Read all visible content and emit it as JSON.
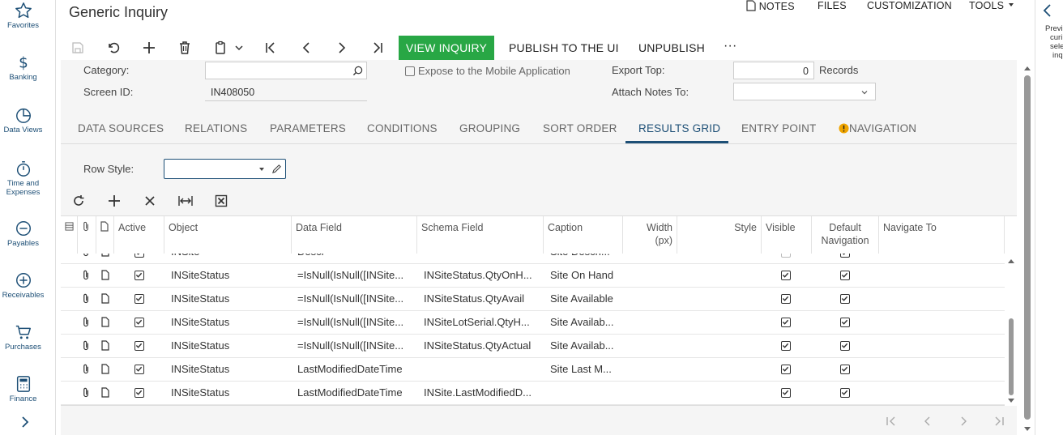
{
  "nav": {
    "items": [
      {
        "label": "Favorites"
      },
      {
        "label": "Banking"
      },
      {
        "label": "Data Views"
      },
      {
        "label": "Time and Expenses",
        "line1": "Time and",
        "line2": "Expenses"
      },
      {
        "label": "Payables"
      },
      {
        "label": "Receivables"
      },
      {
        "label": "Purchases"
      },
      {
        "label": "Finance"
      }
    ]
  },
  "header": {
    "title": "Generic Inquiry",
    "links": {
      "notes": "NOTES",
      "files": "FILES",
      "customization": "CUSTOMIZATION",
      "tools": "TOOLS"
    }
  },
  "toolbar": {
    "view_inquiry": "VIEW INQUIRY",
    "publish": "PUBLISH TO THE UI",
    "unpublish": "UNPUBLISH",
    "more": "···"
  },
  "form": {
    "category_label": "Category:",
    "screen_id_label": "Screen ID:",
    "screen_id_value": "IN408050",
    "expose_label": "Expose to the Mobile Application",
    "export_top_label": "Export Top:",
    "export_top_value": "0",
    "records_label": "Records",
    "attach_notes_label": "Attach Notes To:"
  },
  "tabs": [
    {
      "label": "DATA SOURCES"
    },
    {
      "label": "RELATIONS"
    },
    {
      "label": "PARAMETERS"
    },
    {
      "label": "CONDITIONS"
    },
    {
      "label": "GROUPING"
    },
    {
      "label": "SORT ORDER"
    },
    {
      "label": "RESULTS GRID"
    },
    {
      "label": "ENTRY POINT"
    },
    {
      "label": "NAVIGATION"
    }
  ],
  "results_grid": {
    "row_style_label": "Row Style:",
    "columns": {
      "active": "Active",
      "object": "Object",
      "data_field": "Data Field",
      "schema_field": "Schema Field",
      "caption": "Caption",
      "width_line1": "Width",
      "width_line2": "(px)",
      "style": "Style",
      "visible": "Visible",
      "default_nav_line1": "Default",
      "default_nav_line2": "Navigation",
      "navigate_to": "Navigate To"
    },
    "partial_row": {
      "object": "INSite",
      "data_field": "Descr",
      "caption": "Site Desch..."
    },
    "rows": [
      {
        "object": "INSiteStatus",
        "data_field": "=IsNull(IsNull([INSite...",
        "schema_field": "INSiteStatus.QtyOnH...",
        "caption": "Site On Hand"
      },
      {
        "object": "INSiteStatus",
        "data_field": "=IsNull(IsNull([INSite...",
        "schema_field": "INSiteStatus.QtyAvail",
        "caption": "Site Available"
      },
      {
        "object": "INSiteStatus",
        "data_field": "=IsNull(IsNull([INSite...",
        "schema_field": "INSiteLotSerial.QtyH...",
        "caption": "Site Availab..."
      },
      {
        "object": "INSiteStatus",
        "data_field": "=IsNull(IsNull([INSite...",
        "schema_field": "INSiteStatus.QtyActual",
        "caption": "Site Availab..."
      },
      {
        "object": "INSiteStatus",
        "data_field": "LastModifiedDateTime",
        "schema_field": "",
        "caption": "Site Last M..."
      },
      {
        "object": "INSiteStatus",
        "data_field": "LastModifiedDateTime",
        "schema_field": "INSite.LastModifiedD...",
        "caption": ""
      }
    ]
  },
  "right_panel": {
    "lines": [
      "Previ",
      "curi",
      "sele",
      "inq"
    ]
  }
}
